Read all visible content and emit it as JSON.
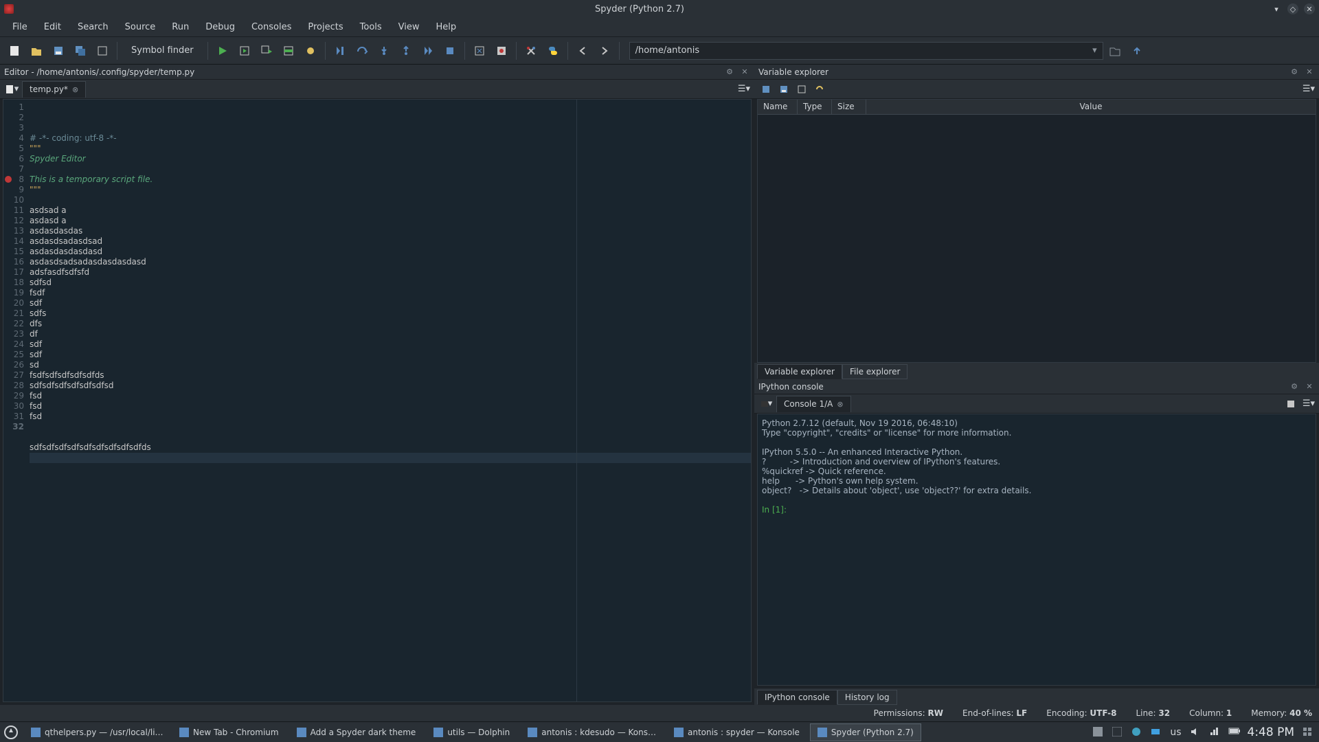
{
  "window": {
    "title": "Spyder (Python 2.7)"
  },
  "menus": [
    "File",
    "Edit",
    "Search",
    "Source",
    "Run",
    "Debug",
    "Consoles",
    "Projects",
    "Tools",
    "View",
    "Help"
  ],
  "toolbar": {
    "symbol_finder": "Symbol finder",
    "working_dir": "/home/antonis"
  },
  "editor_pane": {
    "title": "Editor - /home/antonis/.config/spyder/temp.py",
    "tab_label": "temp.py*"
  },
  "code_lines": [
    {
      "n": 1,
      "t": "# -*- coding: utf-8 -*-",
      "cls": "comment"
    },
    {
      "n": 2,
      "t": "\"\"\"",
      "cls": "str"
    },
    {
      "n": 3,
      "t": "Spyder Editor",
      "cls": "doc"
    },
    {
      "n": 4,
      "t": "",
      "cls": ""
    },
    {
      "n": 5,
      "t": "This is a temporary script file.",
      "cls": "doc"
    },
    {
      "n": 6,
      "t": "\"\"\"",
      "cls": "str"
    },
    {
      "n": 7,
      "t": "",
      "cls": ""
    },
    {
      "n": 8,
      "t": "asdsad a",
      "cls": "",
      "err": true
    },
    {
      "n": 9,
      "t": "asdasd a",
      "cls": ""
    },
    {
      "n": 10,
      "t": "asdasdasdas",
      "cls": ""
    },
    {
      "n": 11,
      "t": "asdasdsadasdsad",
      "cls": ""
    },
    {
      "n": 12,
      "t": "asdasdasdasdasd",
      "cls": ""
    },
    {
      "n": 13,
      "t": "asdasdsadsadasdasdasdasd",
      "cls": ""
    },
    {
      "n": 14,
      "t": "adsfasdfsdfsfd",
      "cls": ""
    },
    {
      "n": 15,
      "t": "sdfsd",
      "cls": ""
    },
    {
      "n": 16,
      "t": "fsdf",
      "cls": ""
    },
    {
      "n": 17,
      "t": "sdf",
      "cls": ""
    },
    {
      "n": 18,
      "t": "sdfs",
      "cls": ""
    },
    {
      "n": 19,
      "t": "dfs",
      "cls": ""
    },
    {
      "n": 20,
      "t": "df",
      "cls": ""
    },
    {
      "n": 21,
      "t": "sdf",
      "cls": ""
    },
    {
      "n": 22,
      "t": "sdf",
      "cls": ""
    },
    {
      "n": 23,
      "t": "sd",
      "cls": ""
    },
    {
      "n": 24,
      "t": "fsdfsdfsdfsdfsdfds",
      "cls": ""
    },
    {
      "n": 25,
      "t": "sdfsdfsdfsdfsdfsdfsd",
      "cls": ""
    },
    {
      "n": 26,
      "t": "fsd",
      "cls": ""
    },
    {
      "n": 27,
      "t": "fsd",
      "cls": ""
    },
    {
      "n": 28,
      "t": "fsd",
      "cls": ""
    },
    {
      "n": 29,
      "t": "",
      "cls": ""
    },
    {
      "n": 30,
      "t": "",
      "cls": ""
    },
    {
      "n": 31,
      "t": "sdfsdfsdfsdfsdfsdfsdfsdfsdfds",
      "cls": ""
    },
    {
      "n": 32,
      "t": "",
      "cls": "",
      "hl": true
    }
  ],
  "var_explorer": {
    "title": "Variable explorer",
    "columns": [
      "Name",
      "Type",
      "Size",
      "Value"
    ],
    "tabs": [
      "Variable explorer",
      "File explorer"
    ],
    "active_tab": 0
  },
  "ipython": {
    "title": "IPython console",
    "tab_label": "Console 1/A",
    "tabs": [
      "IPython console",
      "History log"
    ],
    "active_tab": 0,
    "banner": "Python 2.7.12 (default, Nov 19 2016, 06:48:10)\nType \"copyright\", \"credits\" or \"license\" for more information.\n\nIPython 5.5.0 -- An enhanced Interactive Python.\n?         -> Introduction and overview of IPython's features.\n%quickref -> Quick reference.\nhelp      -> Python's own help system.\nobject?   -> Details about 'object', use 'object??' for extra details.\n",
    "prompt": "In [1]: "
  },
  "statusbar": {
    "permissions_label": "Permissions:",
    "permissions_value": "RW",
    "eol_label": "End-of-lines:",
    "eol_value": "LF",
    "encoding_label": "Encoding:",
    "encoding_value": "UTF-8",
    "line_label": "Line:",
    "line_value": "32",
    "column_label": "Column:",
    "column_value": "1",
    "memory_label": "Memory:",
    "memory_value": "40 %"
  },
  "taskbar": {
    "items": [
      {
        "label": "qthelpers.py — /usr/local/li…",
        "active": false
      },
      {
        "label": "New Tab - Chromium",
        "active": false
      },
      {
        "label": "Add a Spyder dark theme",
        "active": false
      },
      {
        "label": "utils — Dolphin",
        "active": false
      },
      {
        "label": "antonis : kdesudo — Kons…",
        "active": false
      },
      {
        "label": "antonis : spyder — Konsole",
        "active": false
      },
      {
        "label": "Spyder (Python 2.7)",
        "active": true
      }
    ],
    "layout": "us",
    "clock": "4:48 PM"
  }
}
